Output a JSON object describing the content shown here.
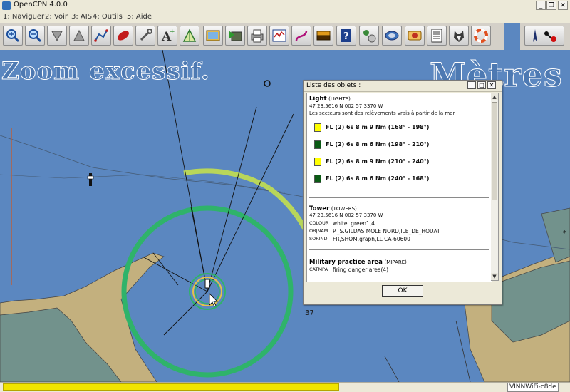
{
  "window": {
    "title": "OpenCPN 4.0.0"
  },
  "menu": [
    "1: Naviguer",
    "2: Voir",
    "3: AIS",
    "4: Outils",
    "5: Aide"
  ],
  "toolbar": {
    "buttons": [
      "zoom-in-icon",
      "zoom-out-icon",
      "scale-down-icon",
      "scale-up-icon",
      "route-icon",
      "mob-icon",
      "tools-icon",
      "text-icon",
      "tides-icon",
      "chart-icon",
      "chart-next-icon",
      "print-icon",
      "settings-icon",
      "track-icon",
      "layers-icon",
      "help-icon",
      "ais-icon",
      "chart-quilt-icon",
      "compass-icon",
      "list-icon",
      "dog-icon",
      "lifebuoy-icon"
    ]
  },
  "map": {
    "overzoom_label": "Zoom excessif.",
    "units_label": "Mètres",
    "depth_label": "37"
  },
  "dialog": {
    "title": "Liste des objets :",
    "light": {
      "name": "Light",
      "code": "(LIGHTS)",
      "position": "47 23.5616 N 002 57.3370 W",
      "note": "Les secteurs sont des relèvements vrais à partir de la mer",
      "sectors": [
        {
          "label": "FL (2) 6s 8 m 9 Nm (168° - 198°)",
          "color": "#ffff00"
        },
        {
          "label": "FL (2) 6s 8 m 6 Nm (198° - 210°)",
          "color": "#0a5a14"
        },
        {
          "label": "FL (2) 6s 8 m 9 Nm (210° - 240°)",
          "color": "#ffff00"
        },
        {
          "label": "FL (2) 6s 8 m 6 Nm (240° - 168°)",
          "color": "#0a5a14"
        }
      ]
    },
    "tower": {
      "name": "Tower",
      "code": "(TOWERS)",
      "position": "47 23.5616 N 002 57.3370 W",
      "attrs": [
        {
          "key": "COLOUR",
          "value": "white, green1,4"
        },
        {
          "key": "OBJNAM",
          "value": "P._S.GILDAS MOLE NORD,ILE_DE_HOUAT"
        },
        {
          "key": "SORIND",
          "value": "FR,SHOM,graph,LL CA-60600"
        }
      ]
    },
    "military": {
      "name": "Military practice area",
      "code": "(MIPARE)",
      "attrs": [
        {
          "key": "CATMPA",
          "value": "firing danger area(4)"
        }
      ]
    },
    "ok_label": "OK"
  },
  "status": {
    "text": "VINNWiFi-c8de",
    "progress": 0.59
  },
  "colors": {
    "sea": "#5b87c0",
    "land": "#c3b07e",
    "shoal": "#72928c",
    "light_yellow": "#b8d65a",
    "light_green": "#2fb36a"
  }
}
